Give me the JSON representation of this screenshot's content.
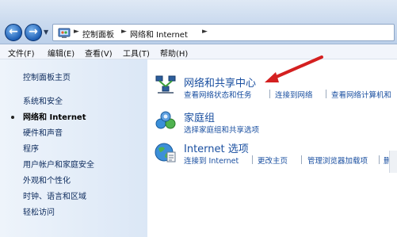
{
  "address": {
    "crumbs": [
      "控制面板",
      "网络和 Internet"
    ]
  },
  "menu": {
    "items": [
      "文件(F)",
      "编辑(E)",
      "查看(V)",
      "工具(T)",
      "帮助(H)"
    ]
  },
  "sidebar": {
    "items": [
      {
        "label": "控制面板主页"
      },
      {
        "label": "系统和安全"
      },
      {
        "label": "网络和 Internet",
        "current": true
      },
      {
        "label": "硬件和声音"
      },
      {
        "label": "程序"
      },
      {
        "label": "用户帐户和家庭安全"
      },
      {
        "label": "外观和个性化"
      },
      {
        "label": "时钟、语言和区域"
      },
      {
        "label": "轻松访问"
      }
    ]
  },
  "categories": [
    {
      "title": "网络和共享中心",
      "icon": "network-sharing-icon",
      "links": [
        "查看网络状态和任务",
        "连接到网络",
        "查看网络计算机和"
      ]
    },
    {
      "title": "家庭组",
      "icon": "homegroup-icon",
      "links": [
        "选择家庭组和共享选项"
      ]
    },
    {
      "title": "Internet 选项",
      "icon": "internet-options-icon",
      "links": [
        "连接到 Internet",
        "更改主页",
        "管理浏览器加载项",
        "删除"
      ]
    }
  ],
  "colors": {
    "link": "#1a4fa0",
    "arrow": "#d42020"
  }
}
